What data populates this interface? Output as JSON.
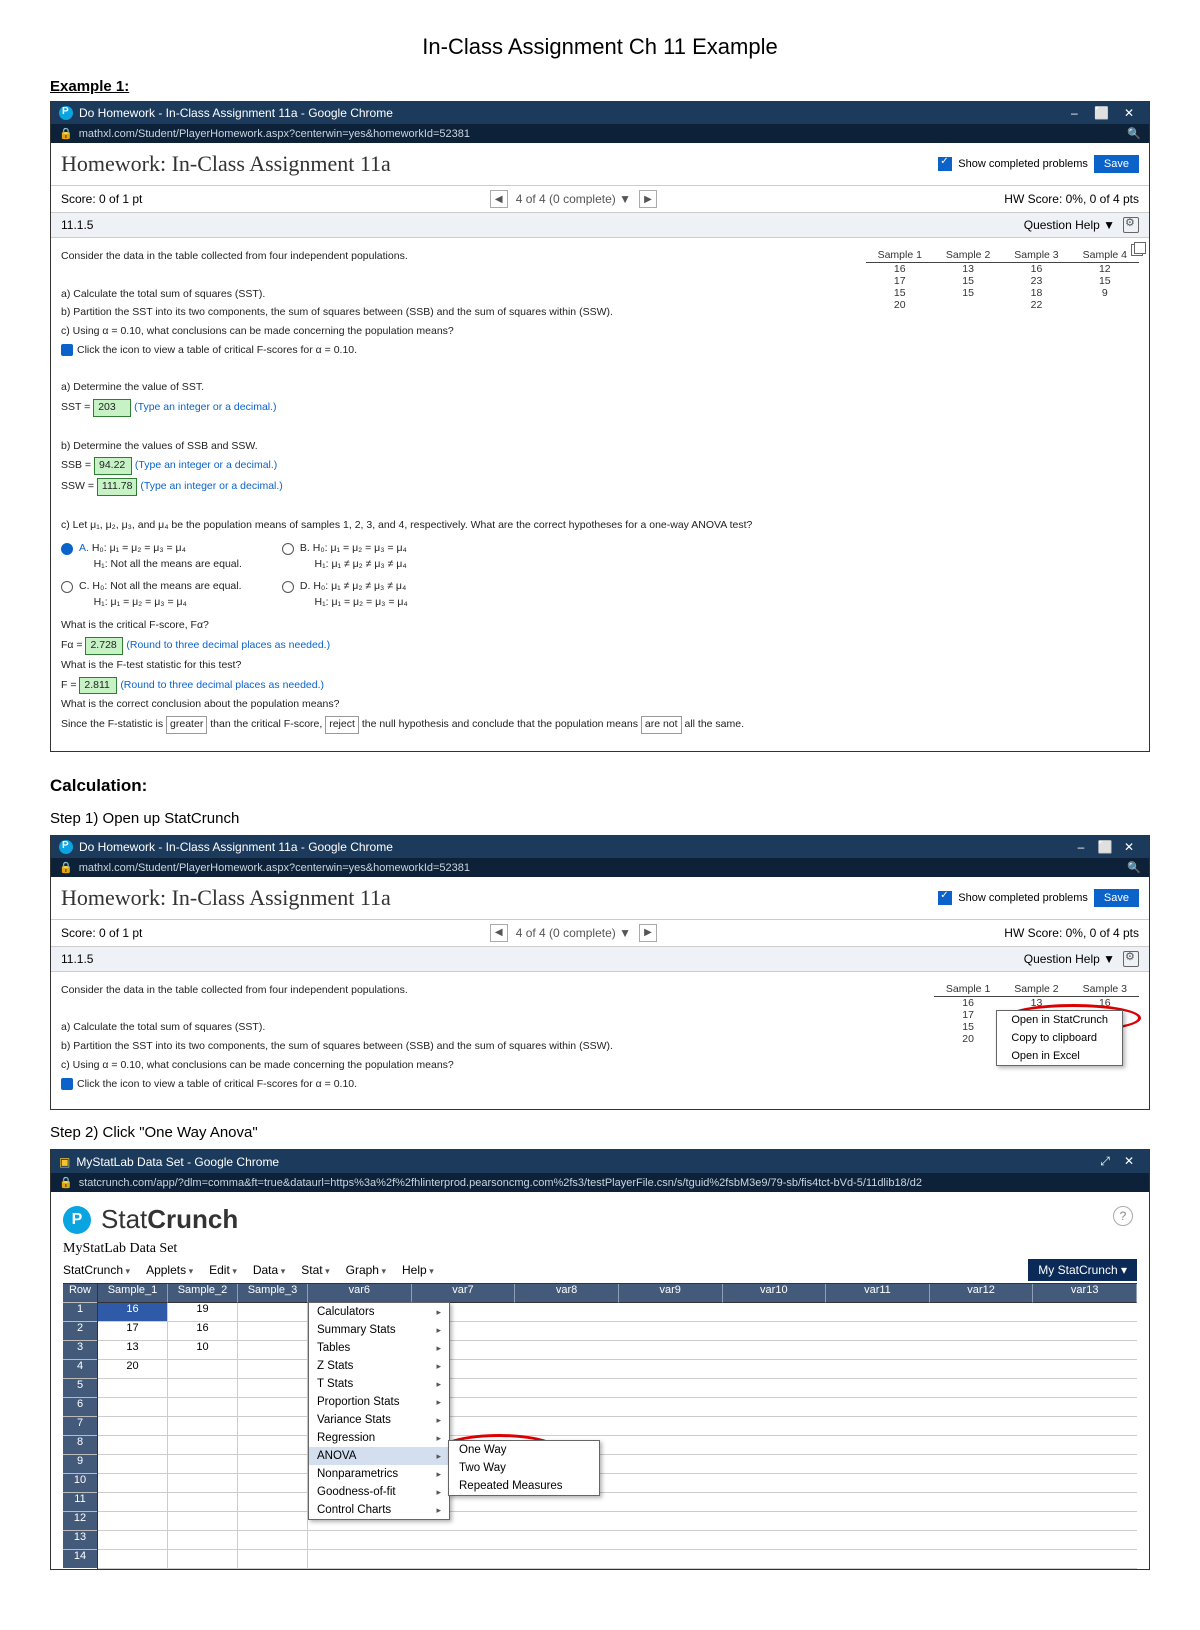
{
  "doc": {
    "title": "In-Class Assignment Ch 11 Example",
    "example_label": "Example 1:",
    "calc_label": "Calculation:",
    "step1": "Step 1) Open up StatCrunch",
    "step2": "Step 2) Click \"One Way Anova\""
  },
  "chrome": {
    "tab1": "Do Homework - In-Class Assignment 11a - Google Chrome",
    "url1": "mathxl.com/Student/PlayerHomework.aspx?centerwin=yes&homeworkId=52381",
    "tab2": "Do Homework - In-Class Assignment 11a - Google Chrome",
    "url2": "mathxl.com/Student/PlayerHomework.aspx?centerwin=yes&homeworkId=52381",
    "tab3": "MyStatLab Data Set - Google Chrome",
    "url3": "statcrunch.com/app/?dlm=comma&ft=true&dataurl=https%3a%2f%2fhlinterprod.pearsoncmg.com%2fs3/testPlayerFile.csn/s/tguid%2fsbM3e9/79-sb/fis4tct-bVd-5/11dlib18/d2",
    "min": "–",
    "max": "⬜",
    "close": "✕",
    "search": "🔍"
  },
  "hw": {
    "title": "Homework: In-Class Assignment 11a",
    "show_completed": "Show completed problems",
    "save": "Save",
    "score": "Score: 0 of 1 pt",
    "pager": "4 of 4 (0 complete) ▼",
    "hw_score": "HW Score: 0%, 0 of 4 pts",
    "qnum": "11.1.5",
    "qhelp": "Question Help ▼"
  },
  "q": {
    "intro": "Consider the data in the table collected from four independent populations.",
    "a": "a) Calculate the total sum of squares (SST).",
    "b": "b) Partition the SST into its two components, the sum of squares between (SSB) and the sum of squares within (SSW).",
    "c": "c) Using α = 0.10, what conclusions can be made concerning the population means?",
    "click_icon": "Click the icon to view a table of critical F-scores for α = 0.10.",
    "a_prompt": "a) Determine the value of SST.",
    "sst_label": "SST =",
    "sst_val": "203",
    "sst_hint": "(Type an integer or a decimal.)",
    "b_prompt": "b) Determine the values of SSB and SSW.",
    "ssb_label": "SSB =",
    "ssb_val": "94.22",
    "ssb_hint": "(Type an integer or a decimal.)",
    "ssw_label": "SSW =",
    "ssw_val": "111.78",
    "ssw_hint": "(Type an integer or a decimal.)",
    "c_prompt": "c) Let μ₁, μ₂, μ₃, and μ₄ be the population means of samples 1, 2, 3, and 4, respectively. What are the correct hypotheses for a one-way ANOVA test?",
    "optA_h0": "H₀: μ₁ = μ₂ = μ₃ = μ₄",
    "optA_h1": "H₁: Not all the means are equal.",
    "optB_h0": "H₀: μ₁ = μ₂ = μ₃ = μ₄",
    "optB_h1": "H₁: μ₁ ≠ μ₂ ≠ μ₃ ≠ μ₄",
    "optC_h0": "H₀: Not all the means are equal.",
    "optC_h1": "H₁: μ₁ = μ₂ = μ₃ = μ₄",
    "optD_h0": "H₀: μ₁ ≠ μ₂ ≠ μ₃ ≠ μ₄",
    "optD_h1": "H₁: μ₁ = μ₂ = μ₃ = μ₄",
    "crit_prompt": "What is the critical F-score, Fα?",
    "fa_label": "Fα =",
    "fa_val": "2.728",
    "fa_hint": "(Round to three decimal places as needed.)",
    "fstat_prompt": "What is the F-test statistic for this test?",
    "f_label": "F =",
    "f_val": "2.811",
    "f_hint": "(Round to three decimal places as needed.)",
    "concl_prompt": "What is the correct conclusion about the population means?",
    "concl_1": "Since the F-statistic is",
    "concl_box1": "greater",
    "concl_2": "than the critical F-score,",
    "concl_box2": "reject",
    "concl_3": "the null hypothesis and conclude that the population means",
    "concl_box3": "are not",
    "concl_4": "all the same."
  },
  "table": {
    "h1": "Sample 1",
    "h2": "Sample 2",
    "h3": "Sample 3",
    "h4": "Sample 4",
    "rows": [
      [
        "16",
        "13",
        "16",
        "12"
      ],
      [
        "17",
        "15",
        "23",
        "15"
      ],
      [
        "15",
        "15",
        "18",
        "9"
      ],
      [
        "20",
        "",
        "22",
        ""
      ]
    ]
  },
  "ctx": {
    "open_sc": "Open in StatCrunch",
    "copy": "Copy to clipboard",
    "open_ex": "Open in Excel"
  },
  "sc": {
    "brand": "Stat",
    "brand2": "Crunch",
    "ds": "MyStatLab Data Set",
    "menus": [
      "StatCrunch",
      "Applets",
      "Edit",
      "Data",
      "Stat",
      "Graph",
      "Help"
    ],
    "my": "My StatCrunch ▾",
    "row_h": "Row",
    "cols": [
      "Sample_1",
      "Sample_2",
      "Sample_3"
    ],
    "extra_cols": [
      "var6",
      "var7",
      "var8",
      "var9",
      "var10",
      "var11",
      "var12",
      "var13"
    ],
    "vals": {
      "c1": [
        "16",
        "17",
        "13",
        "20",
        "",
        "",
        "",
        "",
        "",
        "",
        "",
        "",
        "",
        ""
      ],
      "c2": [
        "19",
        "16",
        "10",
        "",
        "",
        "",
        "",
        "",
        "",
        "",
        "",
        "",
        "",
        ""
      ],
      "c3": [
        "",
        "",
        "",
        "",
        "",
        "",
        "",
        "",
        "",
        "",
        "",
        "",
        "",
        ""
      ]
    },
    "stat_menu": [
      "Calculators",
      "Summary Stats",
      "Tables",
      "Z Stats",
      "T Stats",
      "Proportion Stats",
      "Variance Stats",
      "Regression",
      "ANOVA",
      "Nonparametrics",
      "Goodness-of-fit",
      "Control Charts"
    ],
    "sub": [
      "One Way",
      "Two Way",
      "Repeated Measures"
    ]
  }
}
